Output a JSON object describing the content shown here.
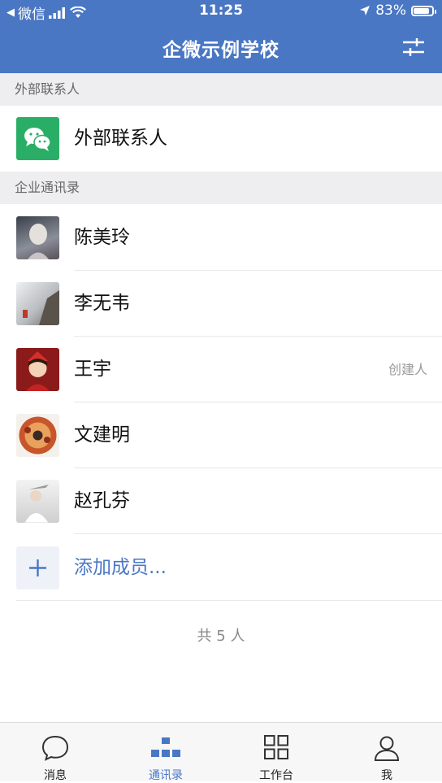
{
  "status_bar": {
    "back_app": "微信",
    "time": "11:25",
    "battery": "83%"
  },
  "header": {
    "title": "企微示例学校"
  },
  "sections": {
    "external": {
      "label": "外部联系人",
      "item": "外部联系人"
    },
    "directory": {
      "label": "企业通讯录"
    }
  },
  "members": [
    {
      "name": "陈美玲",
      "tag": ""
    },
    {
      "name": "李无韦",
      "tag": ""
    },
    {
      "name": "王宇",
      "tag": "创建人"
    },
    {
      "name": "文建明",
      "tag": ""
    },
    {
      "name": "赵孔芬",
      "tag": ""
    }
  ],
  "add_member": "添加成员...",
  "footer": {
    "count": "共 5 人"
  },
  "tabs": [
    {
      "label": "消息",
      "icon": "chat-bubble-icon"
    },
    {
      "label": "通讯录",
      "icon": "org-chart-icon",
      "active": true
    },
    {
      "label": "工作台",
      "icon": "grid-icon"
    },
    {
      "label": "我",
      "icon": "person-icon"
    }
  ],
  "colors": {
    "brand": "#4a77c4",
    "wechat_green": "#2aae67"
  }
}
